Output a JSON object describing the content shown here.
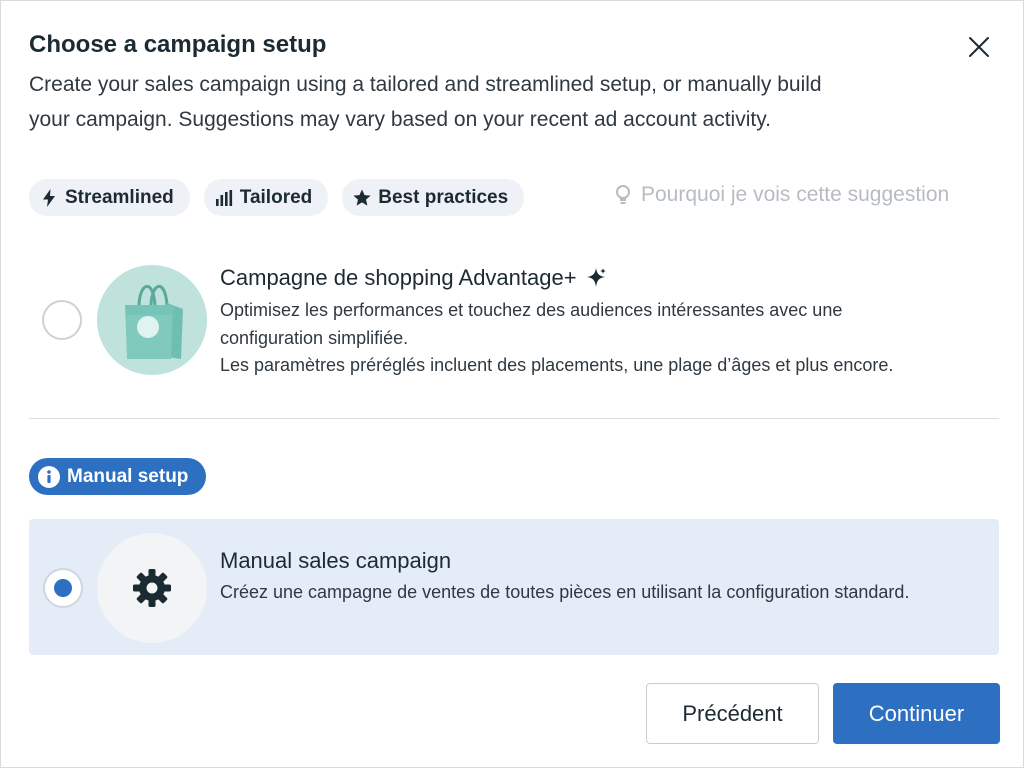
{
  "header": {
    "title": "Choose a campaign setup",
    "subtitle_line1": "Create your sales campaign using a tailored and streamlined setup, or manually build",
    "subtitle_line2": "your campaign. Suggestions may vary based on your recent ad account activity."
  },
  "chips": [
    {
      "label": "Streamlined",
      "icon": "lightning-icon"
    },
    {
      "label": "Tailored",
      "icon": "bar-chart-icon"
    },
    {
      "label": "Best practices",
      "icon": "star-icon"
    }
  ],
  "why_link": {
    "label": "Pourquoi je vois cette suggestion",
    "icon": "lightbulb-icon"
  },
  "option_advantage": {
    "title": "Campagne de shopping Advantage+",
    "desc_line1": "Optimisez les performances et touchez des audiences intéressantes avec une",
    "desc_line2": "configuration simplifiée.",
    "desc_line3": "Les paramètres préréglés incluent des placements, une plage d’âges et plus encore.",
    "selected": false
  },
  "manual_badge": {
    "label": "Manual setup",
    "icon": "info-icon"
  },
  "option_manual": {
    "title": "Manual sales campaign",
    "desc": "Créez une campagne de ventes de toutes pièces en utilisant la configuration standard.",
    "selected": true
  },
  "footer": {
    "prev_label": "Précédent",
    "next_label": "Continuer"
  },
  "colors": {
    "accent": "#2d6fc0",
    "selected_bg": "#e4ecf7",
    "chip_bg": "#eef1f6",
    "bag_bg": "#bfe3dc"
  }
}
